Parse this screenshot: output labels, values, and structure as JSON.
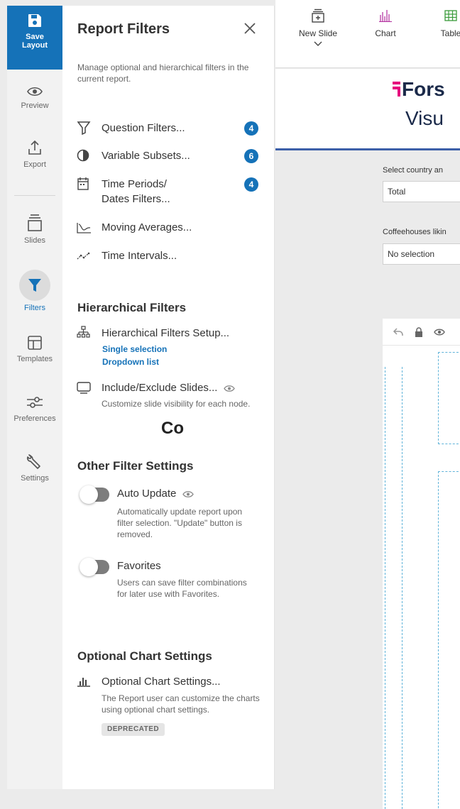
{
  "rail": {
    "save_label_1": "Save",
    "save_label_2": "Layout",
    "items": [
      {
        "label": "Preview",
        "icon": "eye-icon"
      },
      {
        "label": "Export",
        "icon": "export-icon"
      },
      {
        "label": "Slides",
        "icon": "slides-icon"
      },
      {
        "label": "Filters",
        "icon": "filter-icon"
      },
      {
        "label": "Templates",
        "icon": "templates-icon"
      },
      {
        "label": "Preferences",
        "icon": "preferences-icon"
      },
      {
        "label": "Settings",
        "icon": "wrench-icon"
      }
    ],
    "active": "Filters"
  },
  "panel": {
    "title": "Report Filters",
    "description": "Manage optional and hierarchical filters in the current report.",
    "filters": [
      {
        "label": "Question Filters...",
        "badge": "4",
        "icon": "funnel-outline-icon"
      },
      {
        "label": "Variable Subsets...",
        "badge": "6",
        "icon": "circle-subset-icon"
      },
      {
        "label_1": "Time Periods/",
        "label_2": "Dates Filters...",
        "badge": "4",
        "icon": "calendar-icon"
      },
      {
        "label": "Moving Averages...",
        "icon": "moving-average-icon"
      },
      {
        "label": "Time Intervals...",
        "icon": "time-intervals-icon"
      }
    ],
    "hierarchical": {
      "heading": "Hierarchical Filters",
      "setup_label": "Hierarchical Filters Setup...",
      "setup_link_1": "Single selection",
      "setup_link_2": "Dropdown list",
      "include_label": "Include/Exclude Slides...",
      "include_desc": "Customize slide visibility for each node."
    },
    "other": {
      "heading": "Other Filter Settings",
      "auto_update_label": "Auto Update",
      "auto_update_desc": "Automatically update report upon filter selection. \"Update\" button is removed.",
      "favorites_label": "Favorites",
      "favorites_desc": "Users can save filter combinations for later use with Favorites."
    },
    "optional_chart": {
      "heading": "Optional Chart Settings",
      "label": "Optional Chart Settings...",
      "desc": "The Report user can customize the charts using optional chart settings.",
      "tag": "DEPRECATED"
    }
  },
  "toolbar": {
    "new_slide": "New Slide",
    "chart": "Chart",
    "table": "Table"
  },
  "logo": {
    "line1": "Fors",
    "line2": "Visu"
  },
  "filters_area": {
    "country_label": "Select country an",
    "country_value": "Total",
    "coffee_label": "Coffeehouses likin",
    "coffee_value": "No selection"
  },
  "slide": {
    "text": "Co"
  },
  "colors": {
    "accent": "#1572b8",
    "badge": "#1572b8",
    "logo_dark": "#1b2a4a",
    "logo_pink": "#e6007e",
    "chart_icon": "#b02a9c",
    "table_icon": "#3a9a3a"
  }
}
